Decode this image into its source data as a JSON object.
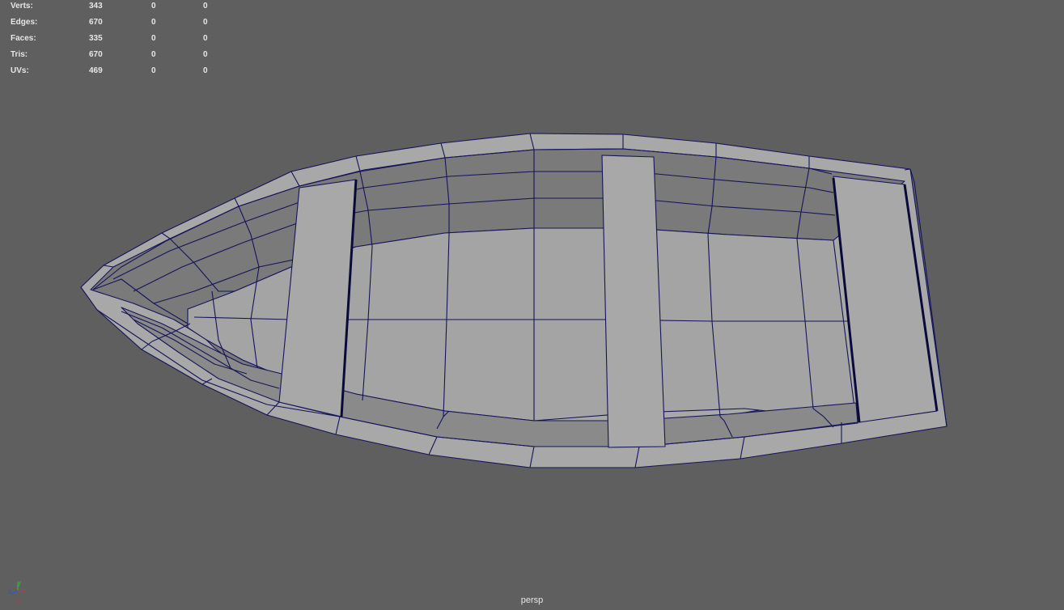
{
  "hud": {
    "rows": [
      {
        "label": "Verts:",
        "v1": "343",
        "v2": "0",
        "v3": "0"
      },
      {
        "label": "Edges:",
        "v1": "670",
        "v2": "0",
        "v3": "0"
      },
      {
        "label": "Faces:",
        "v1": "335",
        "v2": "0",
        "v3": "0"
      },
      {
        "label": "Tris:",
        "v1": "670",
        "v2": "0",
        "v3": "0"
      },
      {
        "label": "UVs:",
        "v1": "469",
        "v2": "0",
        "v3": "0"
      }
    ]
  },
  "viewport": {
    "camera": "persp",
    "background": "#5f5f5f",
    "wire_color": "#14145a"
  },
  "axis_indicator": {
    "x": "x",
    "y": "y",
    "z": "z"
  }
}
